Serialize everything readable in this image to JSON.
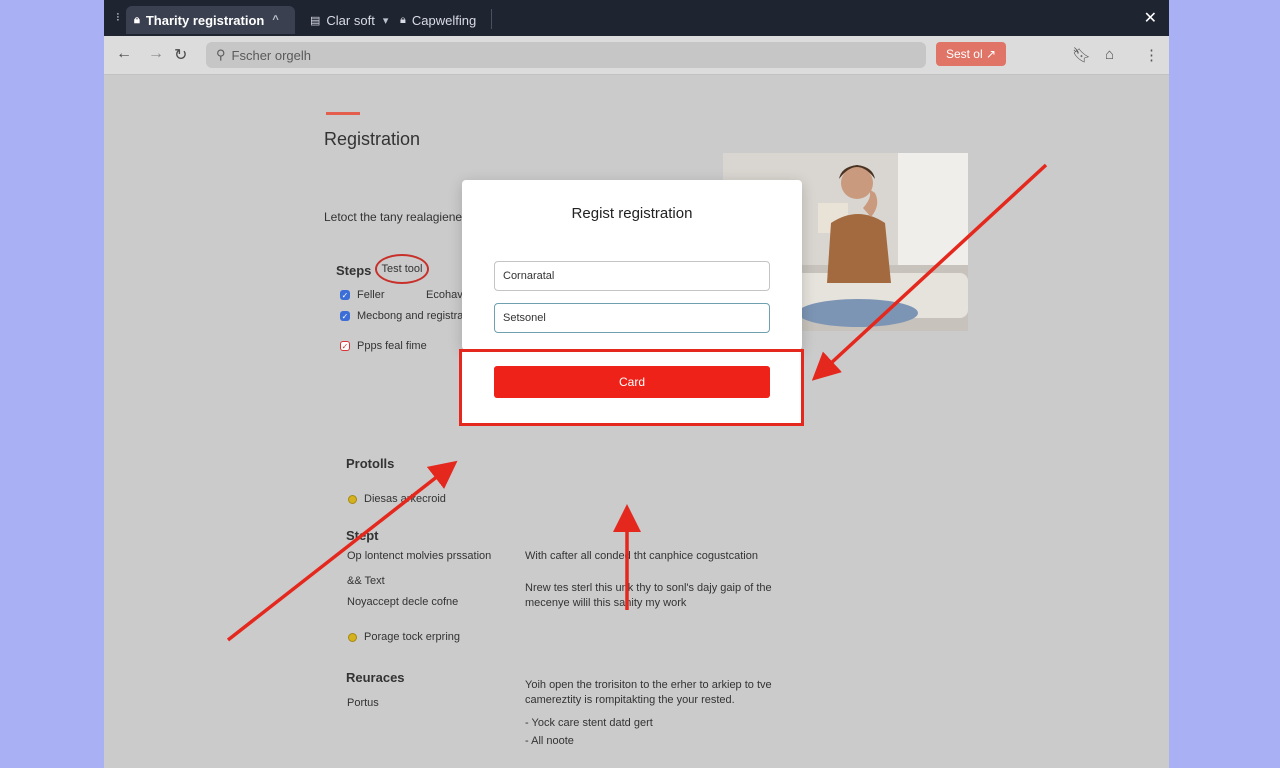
{
  "browser": {
    "tabs": [
      {
        "label": "Tharity registration"
      },
      {
        "label": "Clar soft"
      },
      {
        "label": "Capwelfing"
      }
    ],
    "address_placeholder": "Fscher orgelh",
    "action_pill": "Sest ol ↗"
  },
  "page": {
    "heading": "Registration",
    "lead": "Letoct the tany realagienet in metresloed.",
    "steps": {
      "heading": "Steps",
      "tag": "Test tool",
      "items": [
        "Feller",
        "Mecbong and registrat",
        "Ppps feal fime"
      ],
      "item_extra": "Ecohav"
    },
    "protolls": {
      "heading": "Protolls",
      "items": [
        "Diesas arkecroid"
      ]
    },
    "stept": {
      "heading": "Stept",
      "left_rows": [
        "Op lontenct molvies prssation",
        "&& Text",
        "Noyaccept decle cofne"
      ],
      "bullet": "Porage tock erpring",
      "right_line1": "With cafter all conded tht canphice cogustcation",
      "right_para": "Nrew tes sterl this unk thy to sonl's dajy gaip of the mecenye wilil this sanity my work"
    },
    "resources": {
      "heading": "Reuraces",
      "sub": "Portus",
      "para": "Yoih open the trorisiton to the erher to arkiep to tve camereztity is rompitakting the your rested.",
      "list": [
        "- Yock care stent datd gert",
        "- All noote"
      ]
    }
  },
  "modal": {
    "title": "Regist registration",
    "field1_value": "Cornaratal",
    "field2_value": "Setsonel",
    "button_label": "Card"
  },
  "colors": {
    "accent": "#ee2218",
    "annotation": "#e4281d",
    "checkbox": "#3b6ed6"
  }
}
